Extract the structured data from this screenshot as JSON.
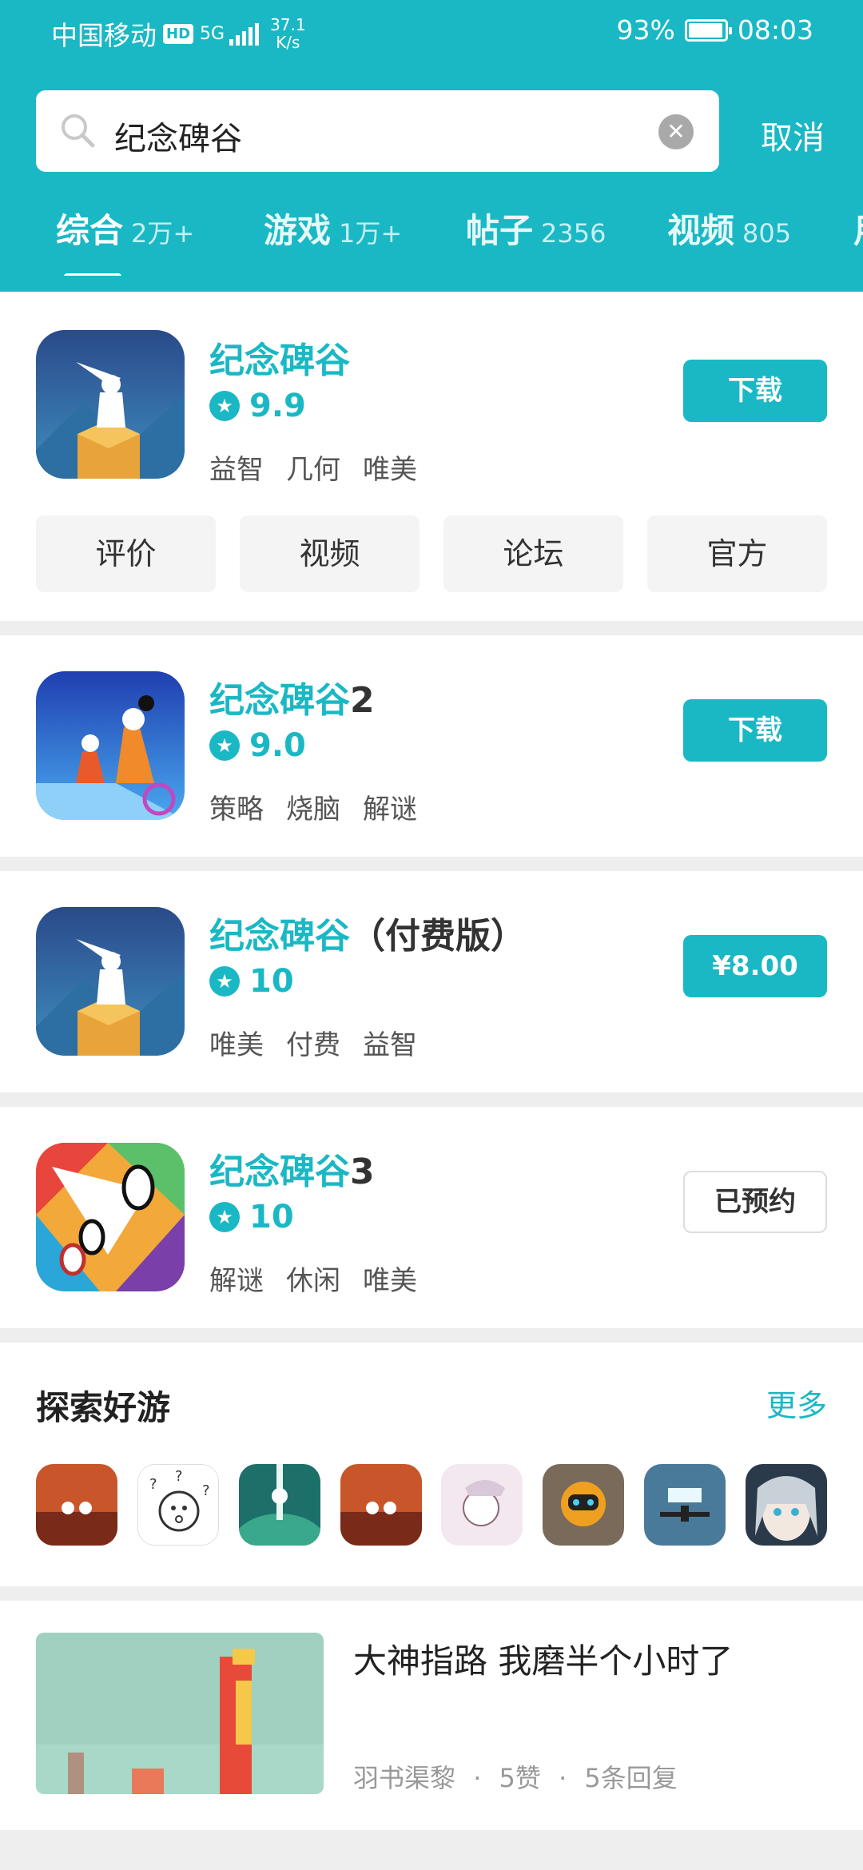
{
  "status": {
    "carrier": "中国移动",
    "hd": "HD",
    "network": "5G",
    "speed_value": "37.1",
    "speed_unit": "K/s",
    "battery": "93%",
    "time": "08:03"
  },
  "search": {
    "query": "纪念碑谷",
    "cancel": "取消"
  },
  "tabs": [
    {
      "label": "综合",
      "count": "2万+"
    },
    {
      "label": "游戏",
      "count": "1万+"
    },
    {
      "label": "帖子",
      "count": "2356"
    },
    {
      "label": "视频",
      "count": "805"
    },
    {
      "label": "用",
      "count": ""
    }
  ],
  "apps": [
    {
      "title": "纪念碑谷",
      "suffix": "",
      "rating": "9.9",
      "tags": [
        "益智",
        "几何",
        "唯美"
      ],
      "action": "下载"
    },
    {
      "title": "纪念碑谷",
      "suffix": "2",
      "rating": "9.0",
      "tags": [
        "策略",
        "烧脑",
        "解谜"
      ],
      "action": "下载"
    },
    {
      "title": "纪念碑谷",
      "suffix": "（付费版）",
      "rating": "10",
      "tags": [
        "唯美",
        "付费",
        "益智"
      ],
      "action": "¥8.00"
    },
    {
      "title": "纪念碑谷",
      "suffix": "3",
      "rating": "10",
      "tags": [
        "解谜",
        "休闲",
        "唯美"
      ],
      "action": "已预约"
    }
  ],
  "quick_links": [
    "评价",
    "视频",
    "论坛",
    "官方"
  ],
  "explore": {
    "title": "探索好游",
    "more": "更多"
  },
  "post": {
    "title": "大神指路  我磨半个小时了",
    "author": "羽书渠黎",
    "likes": "5赞",
    "replies": "5条回复",
    "separator": "·"
  },
  "colors": {
    "accent": "#1ab8c4",
    "divider": "#eeeeee"
  }
}
